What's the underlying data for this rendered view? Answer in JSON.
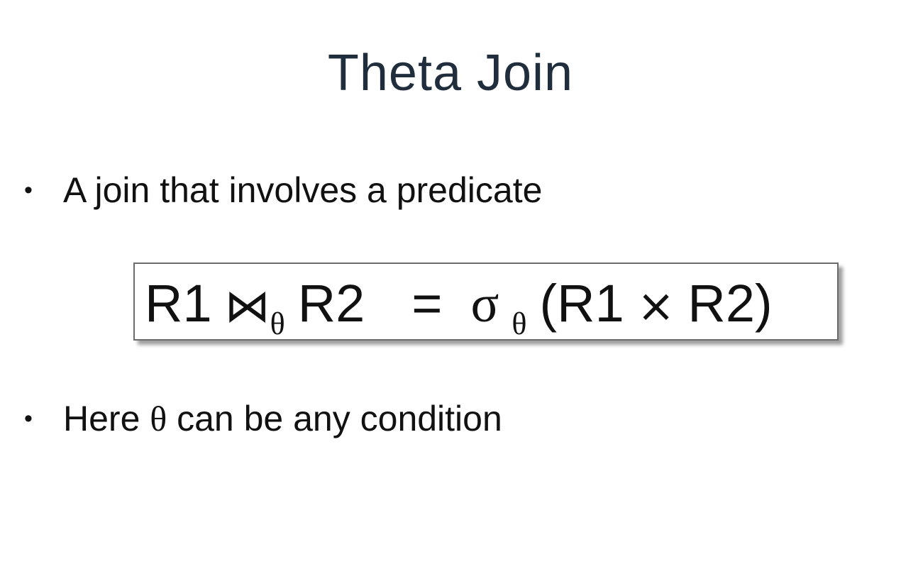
{
  "slide": {
    "title": "Theta Join",
    "bullets": [
      {
        "marker": "•",
        "text": "A join that involves a predicate"
      },
      {
        "marker": "•",
        "text_before": "Here ",
        "symbol": "θ",
        "text_after": " can be any condition"
      }
    ],
    "formula": {
      "left_relation": "R1",
      "join_symbol": "⋈",
      "join_subscript": "θ",
      "right_relation": "R2",
      "equals": "=",
      "select_symbol": "σ",
      "select_subscript": "θ",
      "open_paren": "(",
      "product_left": "R1",
      "product_symbol": "×",
      "product_right": "R2",
      "close_paren": ")"
    }
  }
}
